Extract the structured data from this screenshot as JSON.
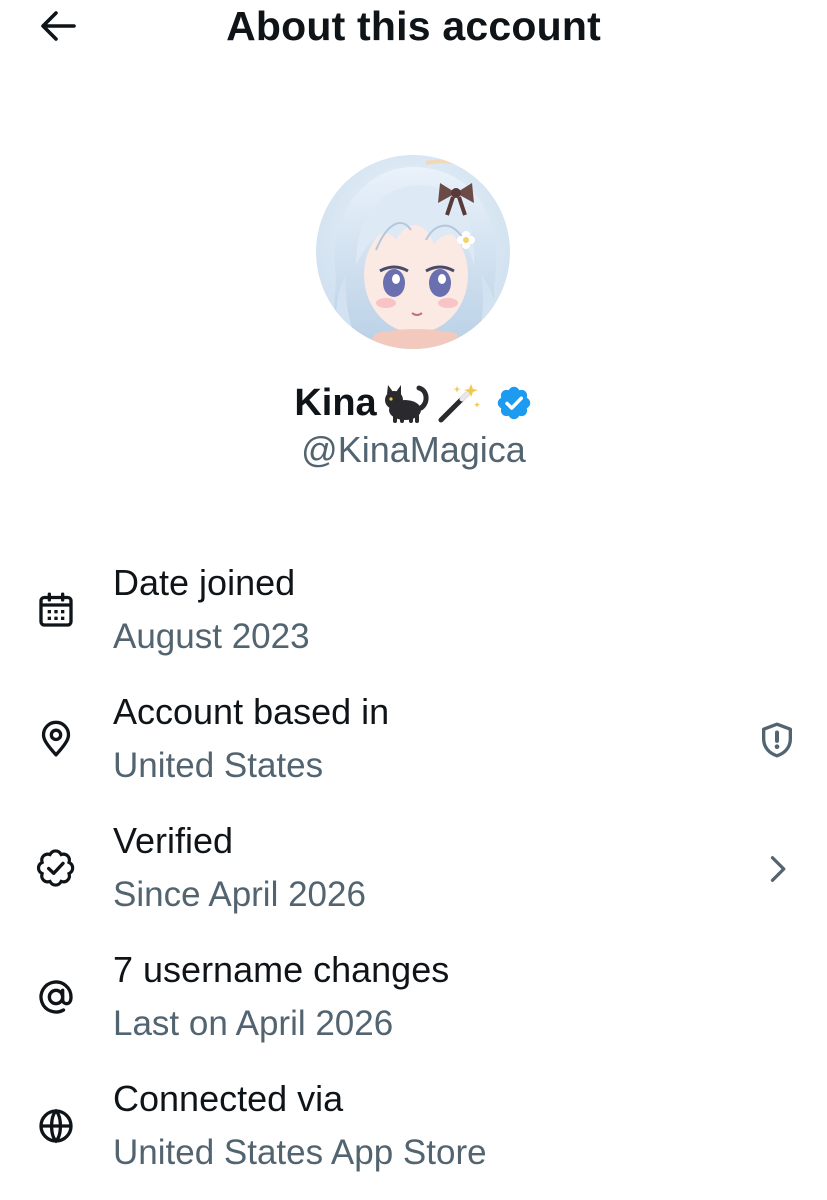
{
  "header": {
    "title": "About this account",
    "back_icon": "arrow-left-icon"
  },
  "profile": {
    "display_name": "Kina",
    "name_emojis": [
      "black-cat-emoji",
      "magic-wand-emoji"
    ],
    "verified_badge": "verified-badge-icon",
    "verified_color": "#1d9bf0",
    "handle": "@KinaMagica"
  },
  "info_rows": [
    {
      "label": "Date joined",
      "value": "August 2023",
      "icon": "calendar-icon",
      "trailing": null
    },
    {
      "label": "Account based in",
      "value": "United States",
      "icon": "location-pin-icon",
      "trailing": "shield-alert-icon"
    },
    {
      "label": "Verified",
      "value": "Since April 2026",
      "icon": "verified-outline-icon",
      "trailing": "chevron-right-icon"
    },
    {
      "label": "7 username changes",
      "value": "Last on April 2026",
      "icon": "at-sign-icon",
      "trailing": null
    },
    {
      "label": "Connected via",
      "value": "United States App Store",
      "icon": "globe-icon",
      "trailing": null
    }
  ],
  "colors": {
    "primary_text": "#0f1419",
    "secondary_text": "#536471",
    "background": "#ffffff"
  }
}
